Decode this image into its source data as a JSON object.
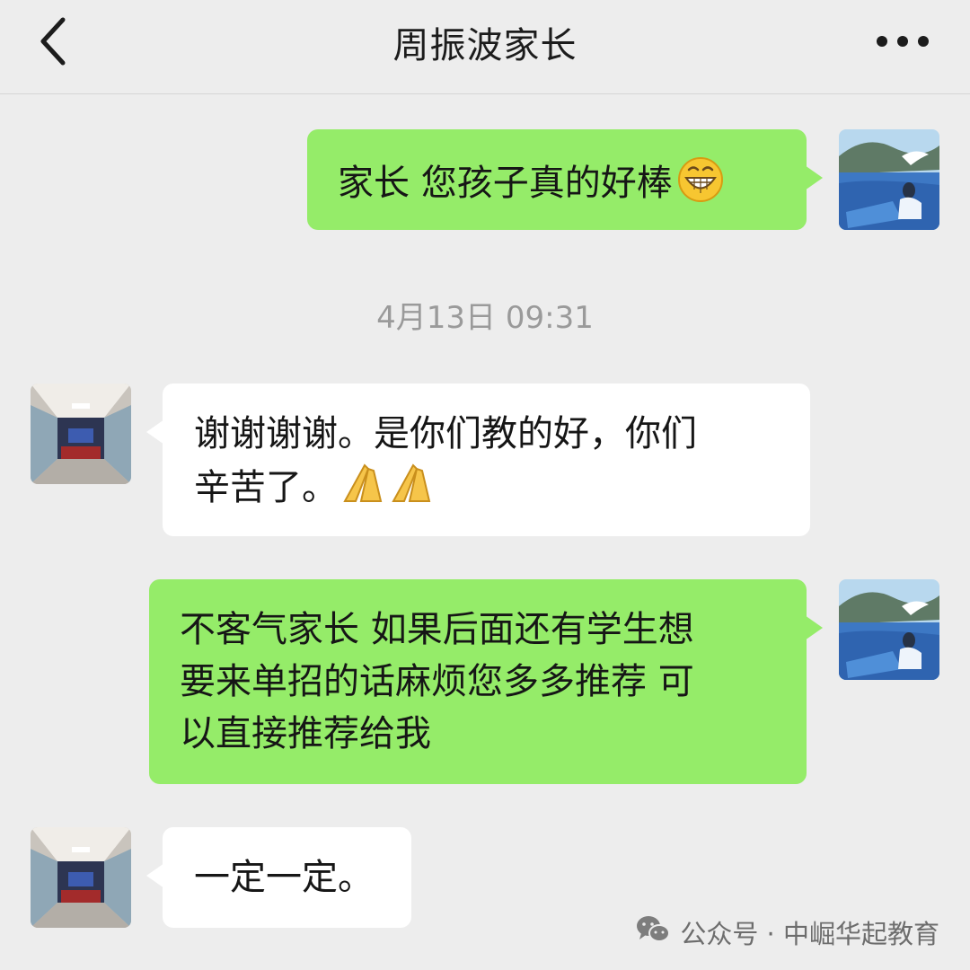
{
  "header": {
    "title": "周振波家长",
    "back_icon": "chevron-left-icon",
    "more_icon": "more-dots-icon"
  },
  "messages": [
    {
      "direction": "outgoing",
      "text": "家长 您孩子真的好棒",
      "emoji": "grinning-face-icon"
    },
    {
      "direction": "incoming",
      "line1": "谢谢谢谢。是你们教的好，你们",
      "line2": "辛苦了。",
      "emoji": "folded-hands-icon"
    },
    {
      "direction": "outgoing",
      "line1": "不客气家长 如果后面还有学生想",
      "line2": "要来单招的话麻烦您多多推荐 可",
      "line3": "以直接推荐给我"
    },
    {
      "direction": "incoming",
      "text": "一定一定。"
    }
  ],
  "timestamp": "4月13日 09:31",
  "watermark": {
    "icon": "wechat-icon",
    "text": "公众号 · 中崛华起教育"
  },
  "colors": {
    "background": "#ededed",
    "outgoing_bubble": "#95ec69",
    "incoming_bubble": "#ffffff",
    "timestamp": "#9a9a9a"
  }
}
